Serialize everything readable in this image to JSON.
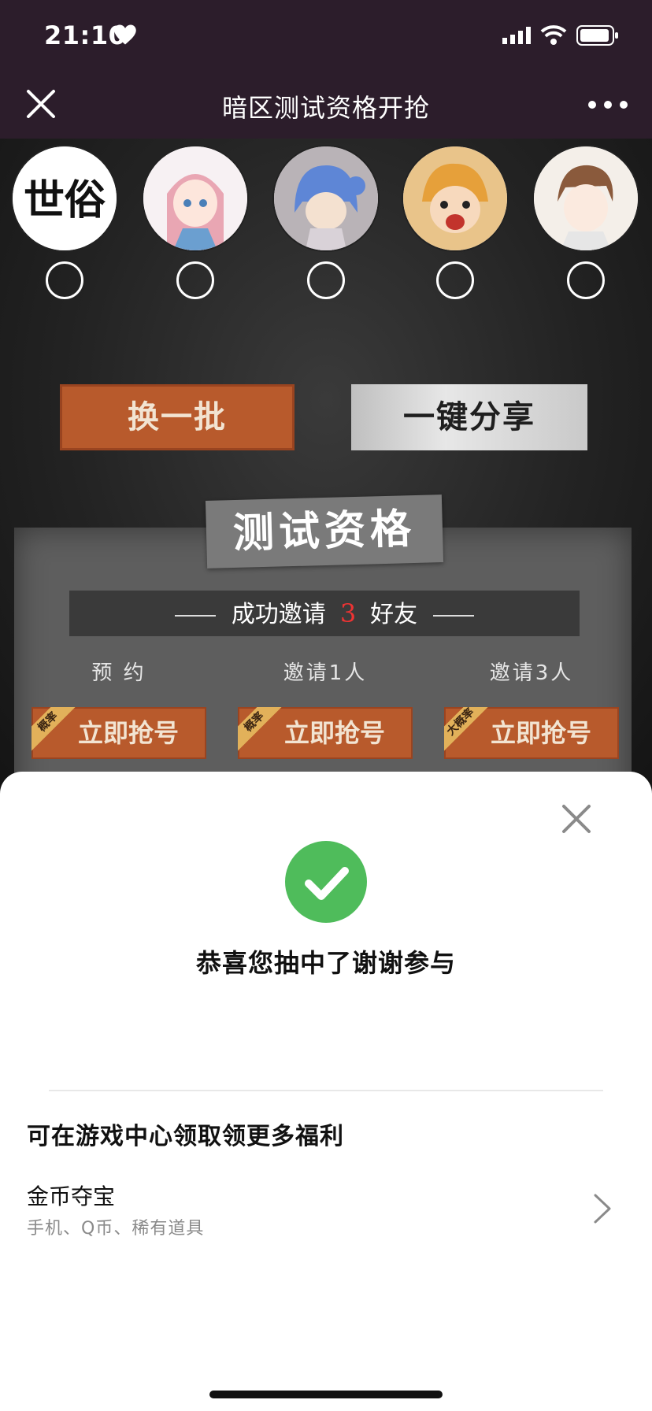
{
  "status": {
    "time": "21:10"
  },
  "nav": {
    "title": "暗区测试资格开抢"
  },
  "game": {
    "avatars": [
      {
        "name": "世俗"
      },
      {
        "name": ""
      },
      {
        "name": ""
      },
      {
        "name": ""
      },
      {
        "name": ""
      }
    ],
    "refresh_label": "换一批",
    "share_label": "一键分享",
    "panel_title": "测试资格",
    "invite_prefix": "成功邀请",
    "invite_count": "3",
    "invite_suffix": "好友",
    "tiers": [
      {
        "label": "预 约",
        "button": "立即抢号",
        "tag": "概率"
      },
      {
        "label": "邀请1人",
        "button": "立即抢号",
        "tag": "概率"
      },
      {
        "label": "邀请3人",
        "button": "立即抢号",
        "tag": "大概率"
      }
    ]
  },
  "sheet": {
    "result": "恭喜您抽中了谢谢参与",
    "more_title": "可在游戏中心领取领更多福利",
    "row_title": "金币夺宝",
    "row_sub": "手机、Q币、稀有道具"
  },
  "colors": {
    "nav_bg": "#2c1d2b",
    "orange_button": "#b85a2c",
    "success_green": "#4fbc5b"
  },
  "icons": [
    "heart-icon",
    "signal-icon",
    "wifi-icon",
    "battery-icon",
    "close-icon",
    "more-icon",
    "check-icon",
    "chevron-right-icon"
  ]
}
